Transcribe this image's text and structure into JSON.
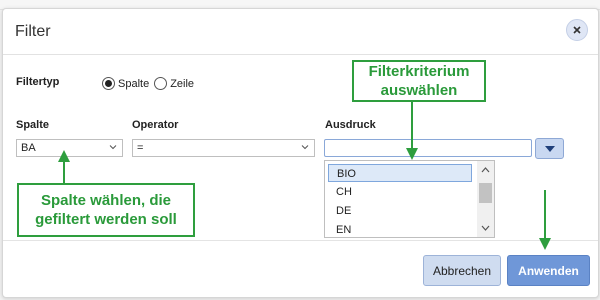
{
  "dialog": {
    "title": "Filter",
    "close_icon": "close-icon"
  },
  "filter_type": {
    "label": "Filtertyp",
    "options": [
      "Spalte",
      "Zeile"
    ],
    "selected": "Spalte"
  },
  "columns": {
    "column_label": "Spalte",
    "operator_label": "Operator",
    "expression_label": "Ausdruck"
  },
  "column_select": {
    "value": "BA"
  },
  "operator_select": {
    "value": "="
  },
  "expression": {
    "value": "",
    "dropdown_items": [
      "BIO",
      "CH",
      "DE",
      "EN"
    ],
    "highlighted": "BIO"
  },
  "footer": {
    "cancel_label": "Abbrechen",
    "apply_label": "Anwenden"
  },
  "callouts": {
    "filter_criterion": "Filterkriterium auswählen",
    "choose_column": "Spalte wählen, die gefiltert werden soll"
  },
  "colors": {
    "accent": "#6f97d8",
    "callout_green": "#2e9e3e"
  }
}
